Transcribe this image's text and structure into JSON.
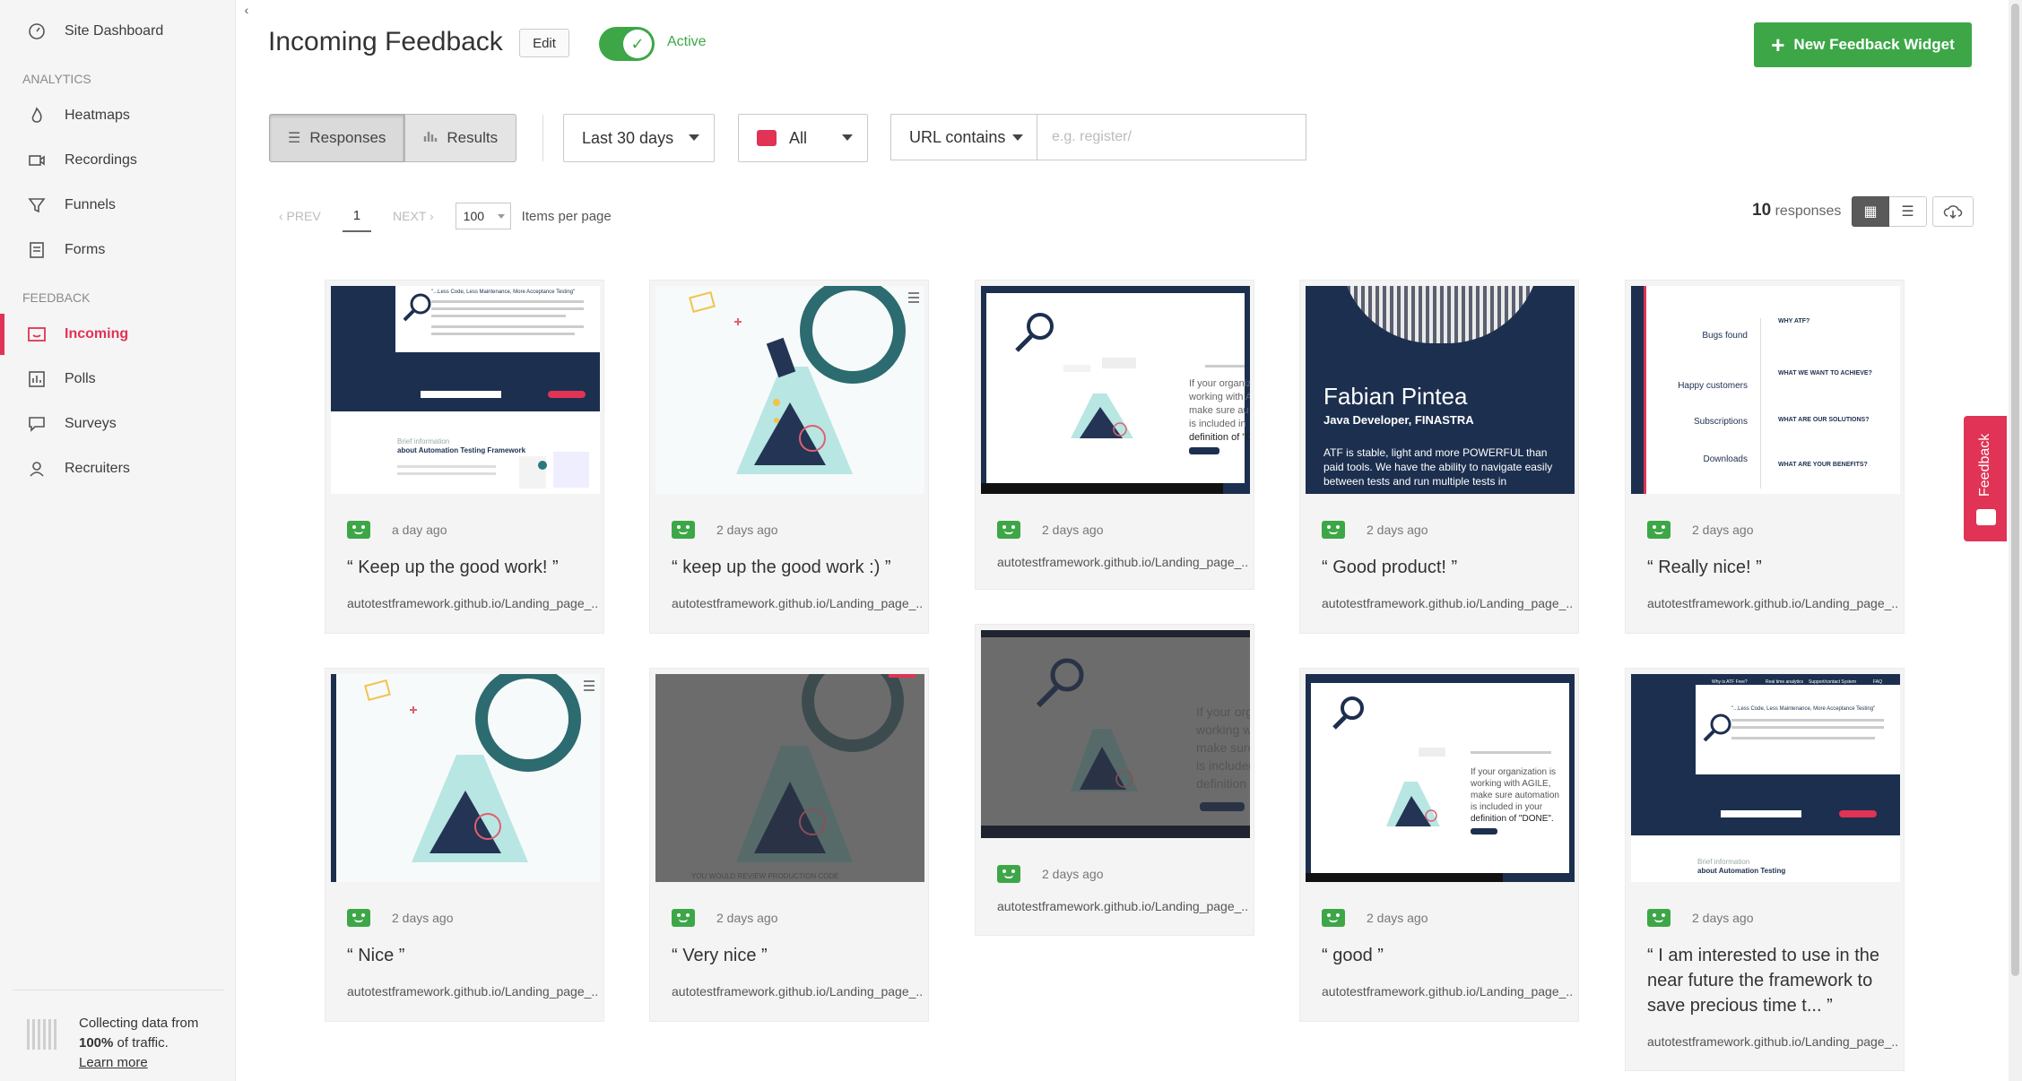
{
  "sidebar": {
    "items": [
      {
        "label": "Site Dashboard",
        "icon": "dashboard-icon"
      },
      {
        "label": "Heatmaps",
        "icon": "flame-icon"
      },
      {
        "label": "Recordings",
        "icon": "video-camera-icon"
      },
      {
        "label": "Funnels",
        "icon": "funnel-icon"
      },
      {
        "label": "Forms",
        "icon": "form-icon"
      },
      {
        "label": "Incoming",
        "icon": "inbox-icon"
      },
      {
        "label": "Polls",
        "icon": "bar-chart-icon"
      },
      {
        "label": "Surveys",
        "icon": "chat-bubble-icon"
      },
      {
        "label": "Recruiters",
        "icon": "user-icon"
      }
    ],
    "section_analytics": "ANALYTICS",
    "section_feedback": "FEEDBACK",
    "footer": {
      "text1": "Collecting data from",
      "pct": "100%",
      "text2": " of traffic.",
      "link": "Learn more"
    }
  },
  "header": {
    "title": "Incoming Feedback",
    "edit": "Edit",
    "toggle_label": "Active",
    "new_button": "New Feedback Widget"
  },
  "filters": {
    "responses": "Responses",
    "results": "Results",
    "period": "Last 30 days",
    "mood": "All",
    "url_mode": "URL contains",
    "url_placeholder": "e.g. register/"
  },
  "pager": {
    "prev": "‹ PREV",
    "page": "1",
    "next": "NEXT ›",
    "per_page": "100",
    "per_page_label": "Items per page",
    "count": "10",
    "count_label": " responses"
  },
  "cards": [
    {
      "time": "a day ago",
      "text": "“ Keep up the good work! ”",
      "url": "autotestframework.github.io/Landing_page_..."
    },
    {
      "time": "2 days ago",
      "text": "“ keep up the good work :) ”",
      "url": "autotestframework.github.io/Landing_page_..."
    },
    {
      "time": "2 days ago",
      "text": "",
      "url": "autotestframework.github.io/Landing_page_..."
    },
    {
      "time": "2 days ago",
      "text": "“ Good product! ”",
      "url": "autotestframework.github.io/Landing_page_..."
    },
    {
      "time": "2 days ago",
      "text": "“ Really nice! ”",
      "url": "autotestframework.github.io/Landing_page_..."
    },
    {
      "time": "2 days ago",
      "text": "“ Nice ”",
      "url": "autotestframework.github.io/Landing_page_..."
    },
    {
      "time": "2 days ago",
      "text": "“ Very nice ”",
      "url": "autotestframework.github.io/Landing_page_..."
    },
    {
      "time": "2 days ago",
      "text": "",
      "url": "autotestframework.github.io/Landing_page_..."
    },
    {
      "time": "2 days ago",
      "text": "“ good ”",
      "url": "autotestframework.github.io/Landing_page_..."
    },
    {
      "time": "2 days ago",
      "text": "“ I am interested to use in the near future the framework to save precious time t... ”",
      "url": "autotestframework.github.io/Landing_page_..."
    }
  ],
  "shot4": {
    "name": "Fabian Pintea",
    "role": "Java Developer, FINASTRA",
    "quote": "ATF is stable, light and more POWERFUL than paid tools. We have the ability to navigate easily between tests and run multiple tests in"
  },
  "shot5": {
    "labels": [
      "Bugs found",
      "Happy customers",
      "Subscriptions",
      "Downloads"
    ],
    "heads": [
      "WHY ATF?",
      "WHAT WE WANT TO ACHIEVE?",
      "WHAT ARE OUR SOLUTIONS?",
      "WHAT ARE YOUR BENEFITS?"
    ]
  },
  "shot_text": {
    "s1_title": "\"...Less Code, Less Maintenance, More Acceptance Testing\"",
    "s1_brief": "Brief information",
    "s1_about": "about Automation Testing Framework",
    "s3_line1": "If your organization is",
    "s3_line2": "working with A",
    "s3_line3": "make sure au",
    "s3_line4": "is included in",
    "s3_line5": "definition of \"D",
    "s9_line1": "If your organization is",
    "s9_line2": "working with AGILE,",
    "s9_line3": "make sure automation",
    "s9_line4": "is included in your",
    "s9_line5": "definition of \"DONE\".",
    "s10_title": "\"...Less Code, Less Maintenance, More Acceptance Testing\"",
    "s10_brief": "Brief information",
    "s10_about": "about Automation Testing",
    "s10_nav": [
      "Why is ATF Free?",
      "Real time analytics",
      "Support/contact System",
      "FAQ"
    ],
    "s7_text": "YOU WOULD REVIEW PRODUCTION CODE"
  },
  "feedback_tab": "Feedback",
  "colors": {
    "accent": "#e03355",
    "green": "#3da748",
    "navy": "#1c2f4f"
  }
}
